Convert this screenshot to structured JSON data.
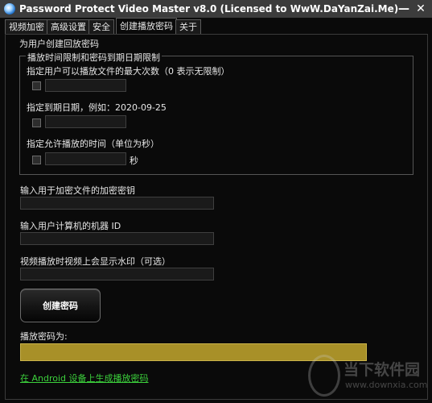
{
  "window": {
    "title": "Password Protect Video Master v8.0 (Licensed to WwW.DaYanZai.Me)",
    "minimize_glyph": "—",
    "close_glyph": "✕"
  },
  "tabs": [
    {
      "label": "视频加密"
    },
    {
      "label": "高级设置"
    },
    {
      "label": "安全"
    },
    {
      "label": "创建播放密码"
    },
    {
      "label": "关于"
    }
  ],
  "section": {
    "title": "为用户创建回放密码",
    "group_title": "播放时间限制和密码到期日期限制",
    "max_plays_label": "指定用户可以播放文件的最大次数（0 表示无限制）",
    "max_plays_value": "",
    "expiry_label": "指定到期日期，例如：2020-09-25",
    "expiry_value": "",
    "duration_label": "指定允许播放的时间（单位为秒）",
    "duration_value": "",
    "duration_unit": "秒"
  },
  "encryption_key": {
    "label": "输入用于加密文件的加密密钥",
    "value": ""
  },
  "machine_id": {
    "label": "输入用户计算机的机器 ID",
    "value": ""
  },
  "watermark_text": {
    "label": "视频播放时视频上会显示水印（可选）",
    "value": ""
  },
  "create_button": {
    "label": "创建密码"
  },
  "result": {
    "label": "播放密码为:",
    "value": ""
  },
  "android_link": {
    "label": "在 Android 设备上生成播放密码"
  },
  "site_watermark": {
    "name": "当下软件园",
    "url": "www.downxia.com"
  },
  "colors": {
    "background": "#0a0a0a",
    "result_bar": "#a89028",
    "link": "#3cd13c"
  }
}
